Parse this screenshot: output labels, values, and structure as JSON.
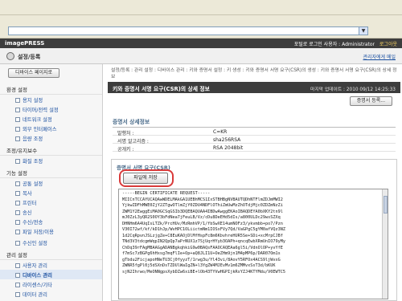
{
  "browser": {
    "dropdown_arrow": "▼"
  },
  "header": {
    "logo": "imagePRESS",
    "links": [
      "포털로 로그인 사용자 : Administrator",
      "로그아웃"
    ]
  },
  "subheader": {
    "title": "설정/등록",
    "right_link": "관리자에게 메일",
    "icon": "settings-icon"
  },
  "sidebar": {
    "top_button": "디바이스 페이지로",
    "groups": [
      {
        "label": "환경 설정",
        "items": [
          "용지 설정",
          "타이머/전력 설정",
          "네트워크 설정",
          "외부 인터페이스",
          "음량 조정"
        ]
      },
      {
        "label": "조정/유지보수",
        "items": [
          "화질 조정"
        ]
      },
      {
        "label": "기능 설정",
        "items": [
          "공통 설정",
          "복사",
          "프린터",
          "송신",
          "수신/전송",
          "파일 저장/이용"
        ]
      },
      {
        "label": "",
        "items": [
          "수신인 설정"
        ]
      },
      {
        "label": "관리 설정",
        "items": [
          "사용자 관리",
          "디바이스 관리",
          "라이센스/기타",
          "데이터 관리"
        ]
      }
    ]
  },
  "main": {
    "breadcrumb": "설정/등록 : 관리 설정 : 디바이스 관리 : 키와 증명서 설정 : 키 생성 : 키와 증명서 서명 요구(CSR)의 생성 : 키와 증명서 서명 요구(CSR)의 상세 정보",
    "page_title": "키와 증명서 서명 요구(CSR)의 상세 정보",
    "updated": "마지막 업데이트 : 2010 09/12 14:25:33",
    "top_button": "증명서 등록...",
    "section_title": "증명서 상세정보",
    "details": [
      {
        "label": "발행처 :",
        "value": "C=KR"
      },
      {
        "label": "서명 알고리즘 :",
        "value": "sha256RSA"
      },
      {
        "label": "공개키 :",
        "value": "RSA  2048bit"
      }
    ],
    "csr_title": "증명서 서명 요구(CSR)",
    "save_button": "파일에 저장",
    "csr_lines": [
      "-----BEGIN CERTIFICATE REQUEST-----",
      "MIICnTCCAYUCAQAwWDELMAkGA1UEBhMCS1IxSTBHBgNVBAUTQDhNTFlmZDJmMWI2",
      "YjkwZDFhMWE0ZjY2ZTgwOTlmZjY0ZDU4NDFlOThiZmUwMzZhOTdjMjc0ZDZmNzZi",
      "ZWM1Y2EwggEiMA0GCSqGSIb3DQEBAQUAA4IBDwAwggEKAoIBAQDEYA0bXKY2tn9l",
      "mJ0ZzL3yQR2S0OY3bFdNea7jFeuLB/Vz/cDu8DeEHd5dIs/a800ULDc29wsSZXq",
      "DHNHm6A4UqIsLTZk/PrcHUv/MzRmhVP/1/fbSwXE14umNOFz3/ykvmbb+po7/Pzn",
      "V30I72wf/kf/kD1hJp/WvHPC1OLiictmNm1IOSxFVy7Qd/VaGPgC5gYM0afVQz3NZ",
      "1d2CqRpvnJSLzjgZe+C8EuKAOjDlMfHspFc8m6KbvhreHUR5Se+SDi+xcMrpCJBf",
      "TNd3V3tdcgmWqpIN2QpQp7aPrNUX1z7SjUqrHYyb3OAPh+qncqEwbXRmUnIO79yMy",
      "ChDq39rFAgMBAAGgADANBgkqhkiG9w0BAQsFAAOCAQEAa6gl5i/VdnOlOP+yvYfE",
      "f7mSc7zBGPg6hHxsg7mqFlIe+Op+aQ8JLI1U+OeZHm9jn1M4pMP6p/DAR07Om1s",
      "gTbdu2FicjapoHNeTU3Cj0fyyzT/1rwg3u/Yl43vi/8AovY5RFOx4ACS9ljWvxG",
      "ZWNR5fgPl0j5dSXnDsTZDUlWaIgZN+l3YgZW4MJEvMv1m6ZMMvxSsT3d/bKUK",
      "sjN2Ihrwo/MeONNgpsXybDZw6xiBE+lOb43TYVwHGPIjkRsYZJ4KTYMdu/V0EWTC5"
    ]
  }
}
